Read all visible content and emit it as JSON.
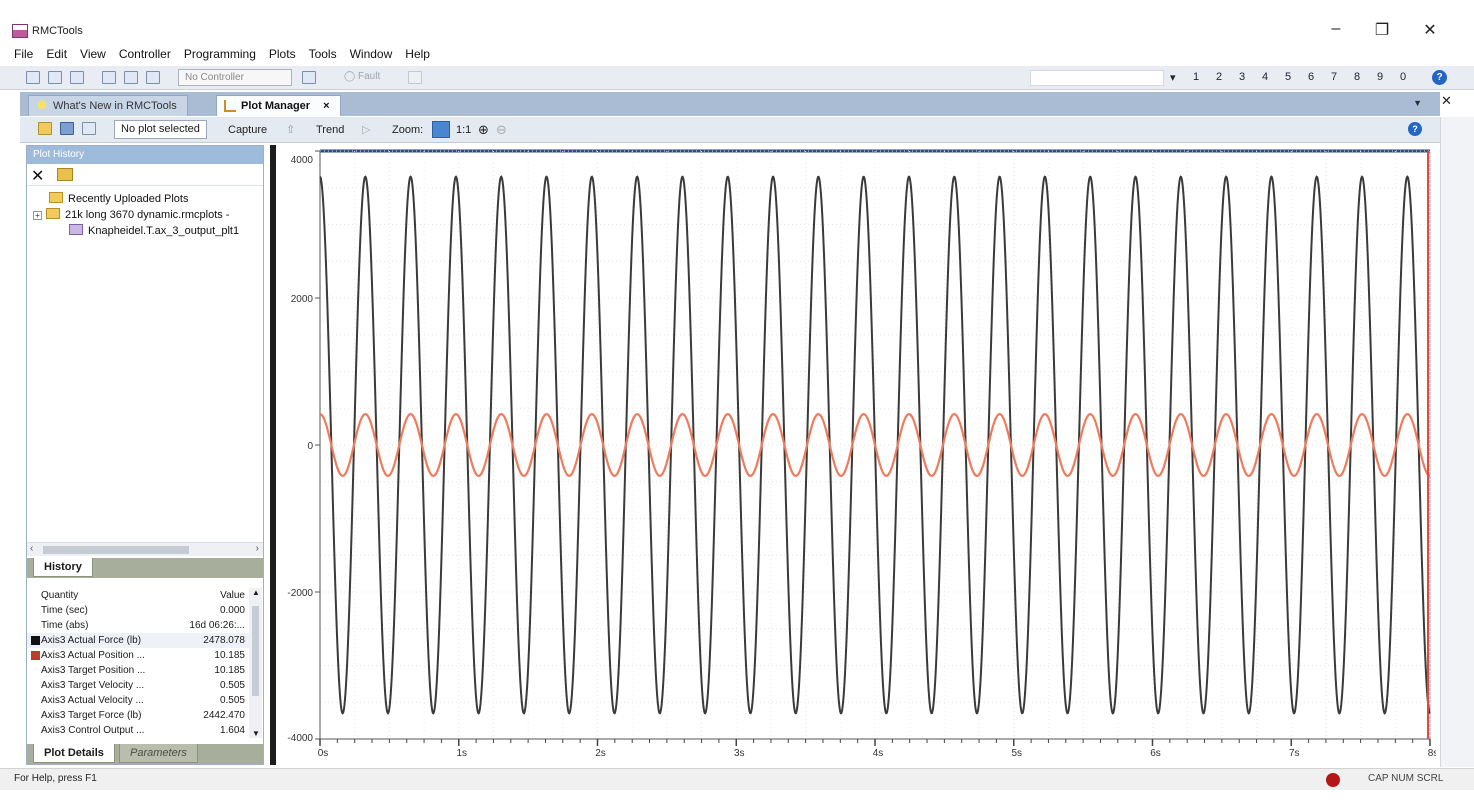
{
  "window": {
    "title": "RMCTools",
    "controls": {
      "minimize": "–",
      "maximize": "❐",
      "close": "✕"
    }
  },
  "menu": [
    "File",
    "Edit",
    "View",
    "Controller",
    "Programming",
    "Plots",
    "Tools",
    "Window",
    "Help"
  ],
  "toolbar": {
    "controller_select": "No Controller",
    "fault_label": "Fault",
    "axis_numbers": [
      "1",
      "2",
      "3",
      "4",
      "5",
      "6",
      "7",
      "8",
      "9",
      "0"
    ],
    "help": "?"
  },
  "tabs": [
    {
      "label": "What's New in RMCTools",
      "icon": "lightbulb-icon"
    },
    {
      "label": "Plot Manager",
      "icon": "plot-icon",
      "close": "×"
    }
  ],
  "plot_toolbar": {
    "selection": "No plot selected",
    "capture": "Capture",
    "trend": "Trend",
    "zoom": "Zoom:",
    "one_to_one": "1:1"
  },
  "plot_history": {
    "header": "Plot History",
    "tree": [
      {
        "label": "Recently Uploaded Plots",
        "icon": "folder-icon"
      },
      {
        "label": "21k long 3670 dynamic.rmcplots -",
        "icon": "folder-icon",
        "expander": "+"
      },
      {
        "label": "Knapheidel.T.ax_3_output_plt1",
        "icon": "file-icon"
      }
    ],
    "tab": "History"
  },
  "plot_details": {
    "columns": {
      "quantity": "Quantity",
      "value": "Value"
    },
    "rows": [
      {
        "name": "Time (sec)",
        "value": "0.000",
        "color": ""
      },
      {
        "name": "Time (abs)",
        "value": "16d 06:26:...",
        "color": ""
      },
      {
        "name": "Axis3 Actual Force (lb)",
        "value": "2478.078",
        "color": "#111111"
      },
      {
        "name": "Axis3 Actual Position ...",
        "value": "10.185",
        "color": "#c0392b"
      },
      {
        "name": "Axis3 Target Position ...",
        "value": "10.185",
        "color": ""
      },
      {
        "name": "Axis3 Target Velocity ...",
        "value": "0.505",
        "color": ""
      },
      {
        "name": "Axis3 Actual Velocity ...",
        "value": "0.505",
        "color": ""
      },
      {
        "name": "Axis3 Target Force (lb)",
        "value": "2442.470",
        "color": ""
      },
      {
        "name": "Axis3 Control Output ...",
        "value": "1.604",
        "color": ""
      }
    ],
    "tabs": [
      "Plot Details",
      "Parameters"
    ]
  },
  "status": {
    "help_text": "For Help, press F1",
    "keys": "CAP NUM SCRL"
  },
  "colors": {
    "force_series": "#3a3a3a",
    "position_series": "#f07a5c",
    "cursor_line": "#e8453c"
  },
  "chart_data": {
    "type": "line",
    "ylim": [
      -4000,
      4000
    ],
    "y_ticks": [
      4000,
      2000,
      0,
      -2000,
      -4000
    ],
    "x_tick_labels": [
      "0s",
      "1s",
      "2s",
      "3s",
      "4s",
      "5s",
      "6s",
      "7s",
      "8s"
    ],
    "xlim": [
      0,
      8
    ],
    "series": [
      {
        "name": "Axis3 Actual Force (lb)",
        "amplitude": 3650,
        "offset": 0,
        "cycles": 24.5,
        "color": "#3a3a3a"
      },
      {
        "name": "Axis3 Actual Position ...",
        "amplitude": 420,
        "offset": 0,
        "cycles": 24.5,
        "color": "#f07a5c"
      }
    ],
    "grid": true
  }
}
